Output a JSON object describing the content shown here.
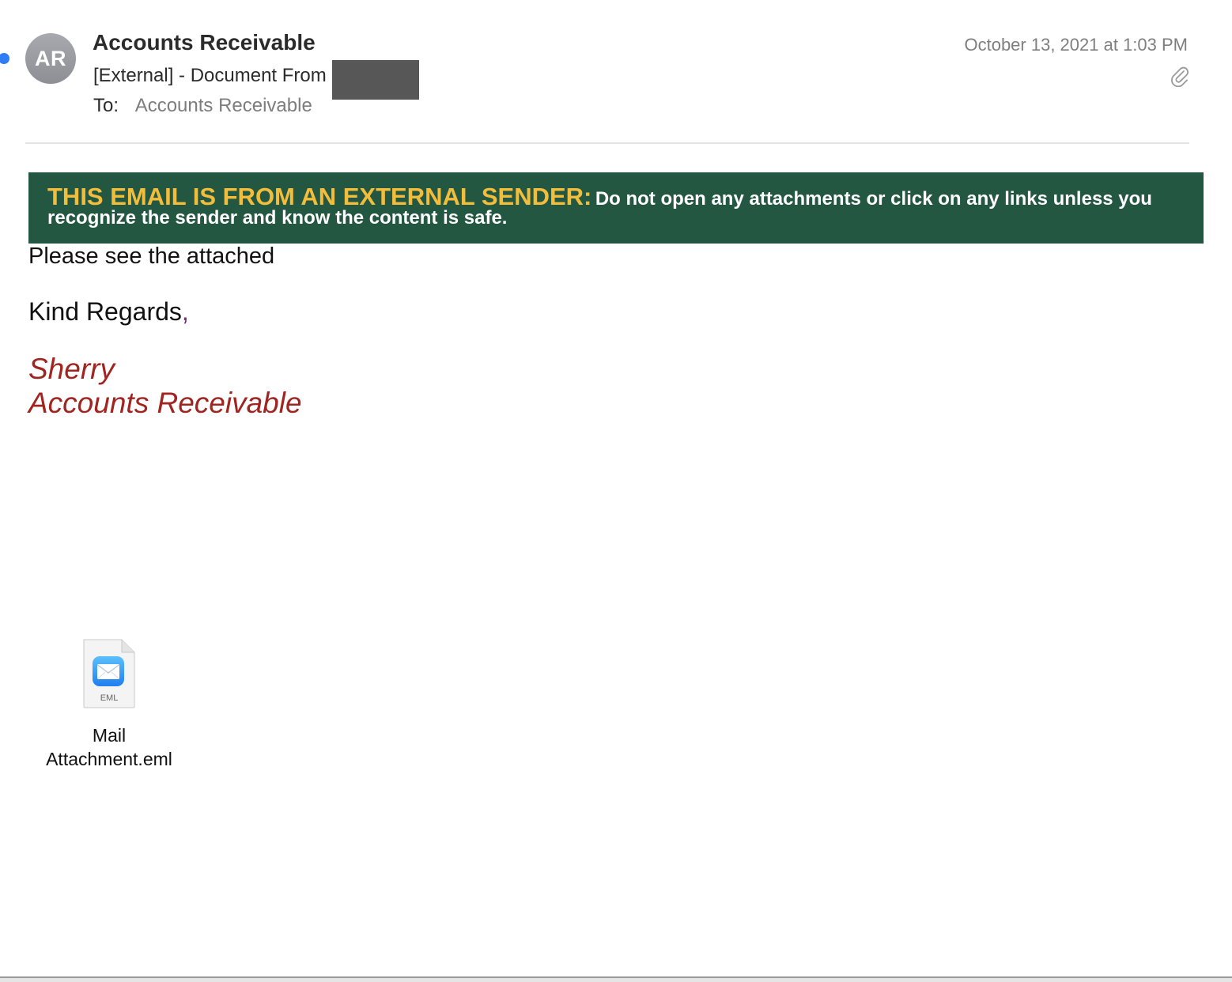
{
  "message": {
    "unread": true,
    "avatar_initials": "AR",
    "sender_name": "Accounts Receivable",
    "subject": "[External] - Document From",
    "to_label": "To:",
    "to_value": "Accounts Receivable",
    "date": "October 13, 2021 at 1:03 PM"
  },
  "banner": {
    "lead": "THIS EMAIL IS FROM AN EXTERNAL SENDER:",
    "rest": "Do not open any attachments or click on any links unless you recognize the sender and know the content is safe.",
    "background": "#245741",
    "lead_color": "#f2bd3b"
  },
  "body": {
    "greeting": "Please see the attached",
    "closing": "Kind Regards",
    "closing_punct": ",",
    "signature_name": "Sherry",
    "signature_dept": "Accounts Receivable",
    "signature_color": "#a0241f"
  },
  "attachment": {
    "file_type": "EML",
    "file_name": "Mail Attachment.eml"
  },
  "colors": {
    "unread_dot": "#2f7cf6",
    "mail_icon_blue": "#2b8ff0"
  },
  "icons": {
    "attachment_indicator": "paperclip-icon",
    "file": "eml-file-icon"
  }
}
